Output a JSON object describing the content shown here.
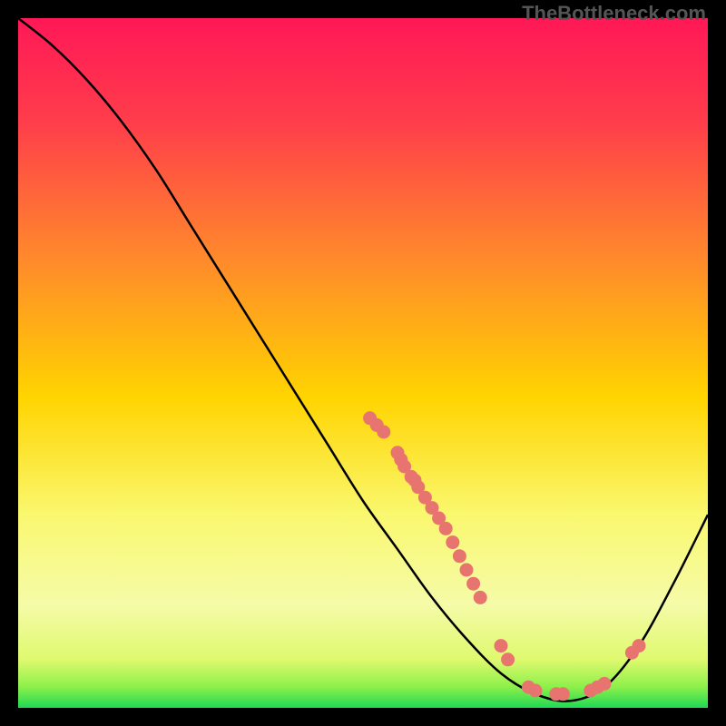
{
  "watermark": "TheBottleneck.com",
  "chart_data": {
    "type": "line",
    "title": "",
    "xlabel": "",
    "ylabel": "",
    "xlim": [
      0,
      100
    ],
    "ylim": [
      0,
      100
    ],
    "curve": [
      {
        "x": 0,
        "y": 100
      },
      {
        "x": 5,
        "y": 96
      },
      {
        "x": 10,
        "y": 91
      },
      {
        "x": 15,
        "y": 85
      },
      {
        "x": 20,
        "y": 78
      },
      {
        "x": 25,
        "y": 70
      },
      {
        "x": 30,
        "y": 62
      },
      {
        "x": 35,
        "y": 54
      },
      {
        "x": 40,
        "y": 46
      },
      {
        "x": 45,
        "y": 38
      },
      {
        "x": 50,
        "y": 30
      },
      {
        "x": 55,
        "y": 23
      },
      {
        "x": 60,
        "y": 16
      },
      {
        "x": 65,
        "y": 10
      },
      {
        "x": 70,
        "y": 5
      },
      {
        "x": 75,
        "y": 2
      },
      {
        "x": 80,
        "y": 1
      },
      {
        "x": 85,
        "y": 3
      },
      {
        "x": 90,
        "y": 9
      },
      {
        "x": 95,
        "y": 18
      },
      {
        "x": 100,
        "y": 28
      }
    ],
    "points": [
      {
        "x": 51,
        "y": 42
      },
      {
        "x": 52,
        "y": 41
      },
      {
        "x": 53,
        "y": 40
      },
      {
        "x": 55,
        "y": 37
      },
      {
        "x": 55.5,
        "y": 36
      },
      {
        "x": 56,
        "y": 35
      },
      {
        "x": 57,
        "y": 33.5
      },
      {
        "x": 57.5,
        "y": 33
      },
      {
        "x": 58,
        "y": 32
      },
      {
        "x": 59,
        "y": 30.5
      },
      {
        "x": 60,
        "y": 29
      },
      {
        "x": 61,
        "y": 27.5
      },
      {
        "x": 62,
        "y": 26
      },
      {
        "x": 63,
        "y": 24
      },
      {
        "x": 64,
        "y": 22
      },
      {
        "x": 65,
        "y": 20
      },
      {
        "x": 66,
        "y": 18
      },
      {
        "x": 67,
        "y": 16
      },
      {
        "x": 70,
        "y": 9
      },
      {
        "x": 71,
        "y": 7
      },
      {
        "x": 74,
        "y": 3
      },
      {
        "x": 75,
        "y": 2.5
      },
      {
        "x": 78,
        "y": 2
      },
      {
        "x": 79,
        "y": 2
      },
      {
        "x": 83,
        "y": 2.5
      },
      {
        "x": 84,
        "y": 3
      },
      {
        "x": 85,
        "y": 3.5
      },
      {
        "x": 89,
        "y": 8
      },
      {
        "x": 90,
        "y": 9
      }
    ],
    "gradient_stops": [
      {
        "offset": 0,
        "color": "#ff1857"
      },
      {
        "offset": 0.15,
        "color": "#ff3d4b"
      },
      {
        "offset": 0.35,
        "color": "#ff8a2b"
      },
      {
        "offset": 0.55,
        "color": "#ffd400"
      },
      {
        "offset": 0.72,
        "color": "#faf86f"
      },
      {
        "offset": 0.85,
        "color": "#f5fba8"
      },
      {
        "offset": 0.93,
        "color": "#dff96e"
      },
      {
        "offset": 0.97,
        "color": "#8cf04a"
      },
      {
        "offset": 1.0,
        "color": "#1fd855"
      }
    ],
    "point_color": "#e8746f",
    "curve_color": "#000000"
  }
}
